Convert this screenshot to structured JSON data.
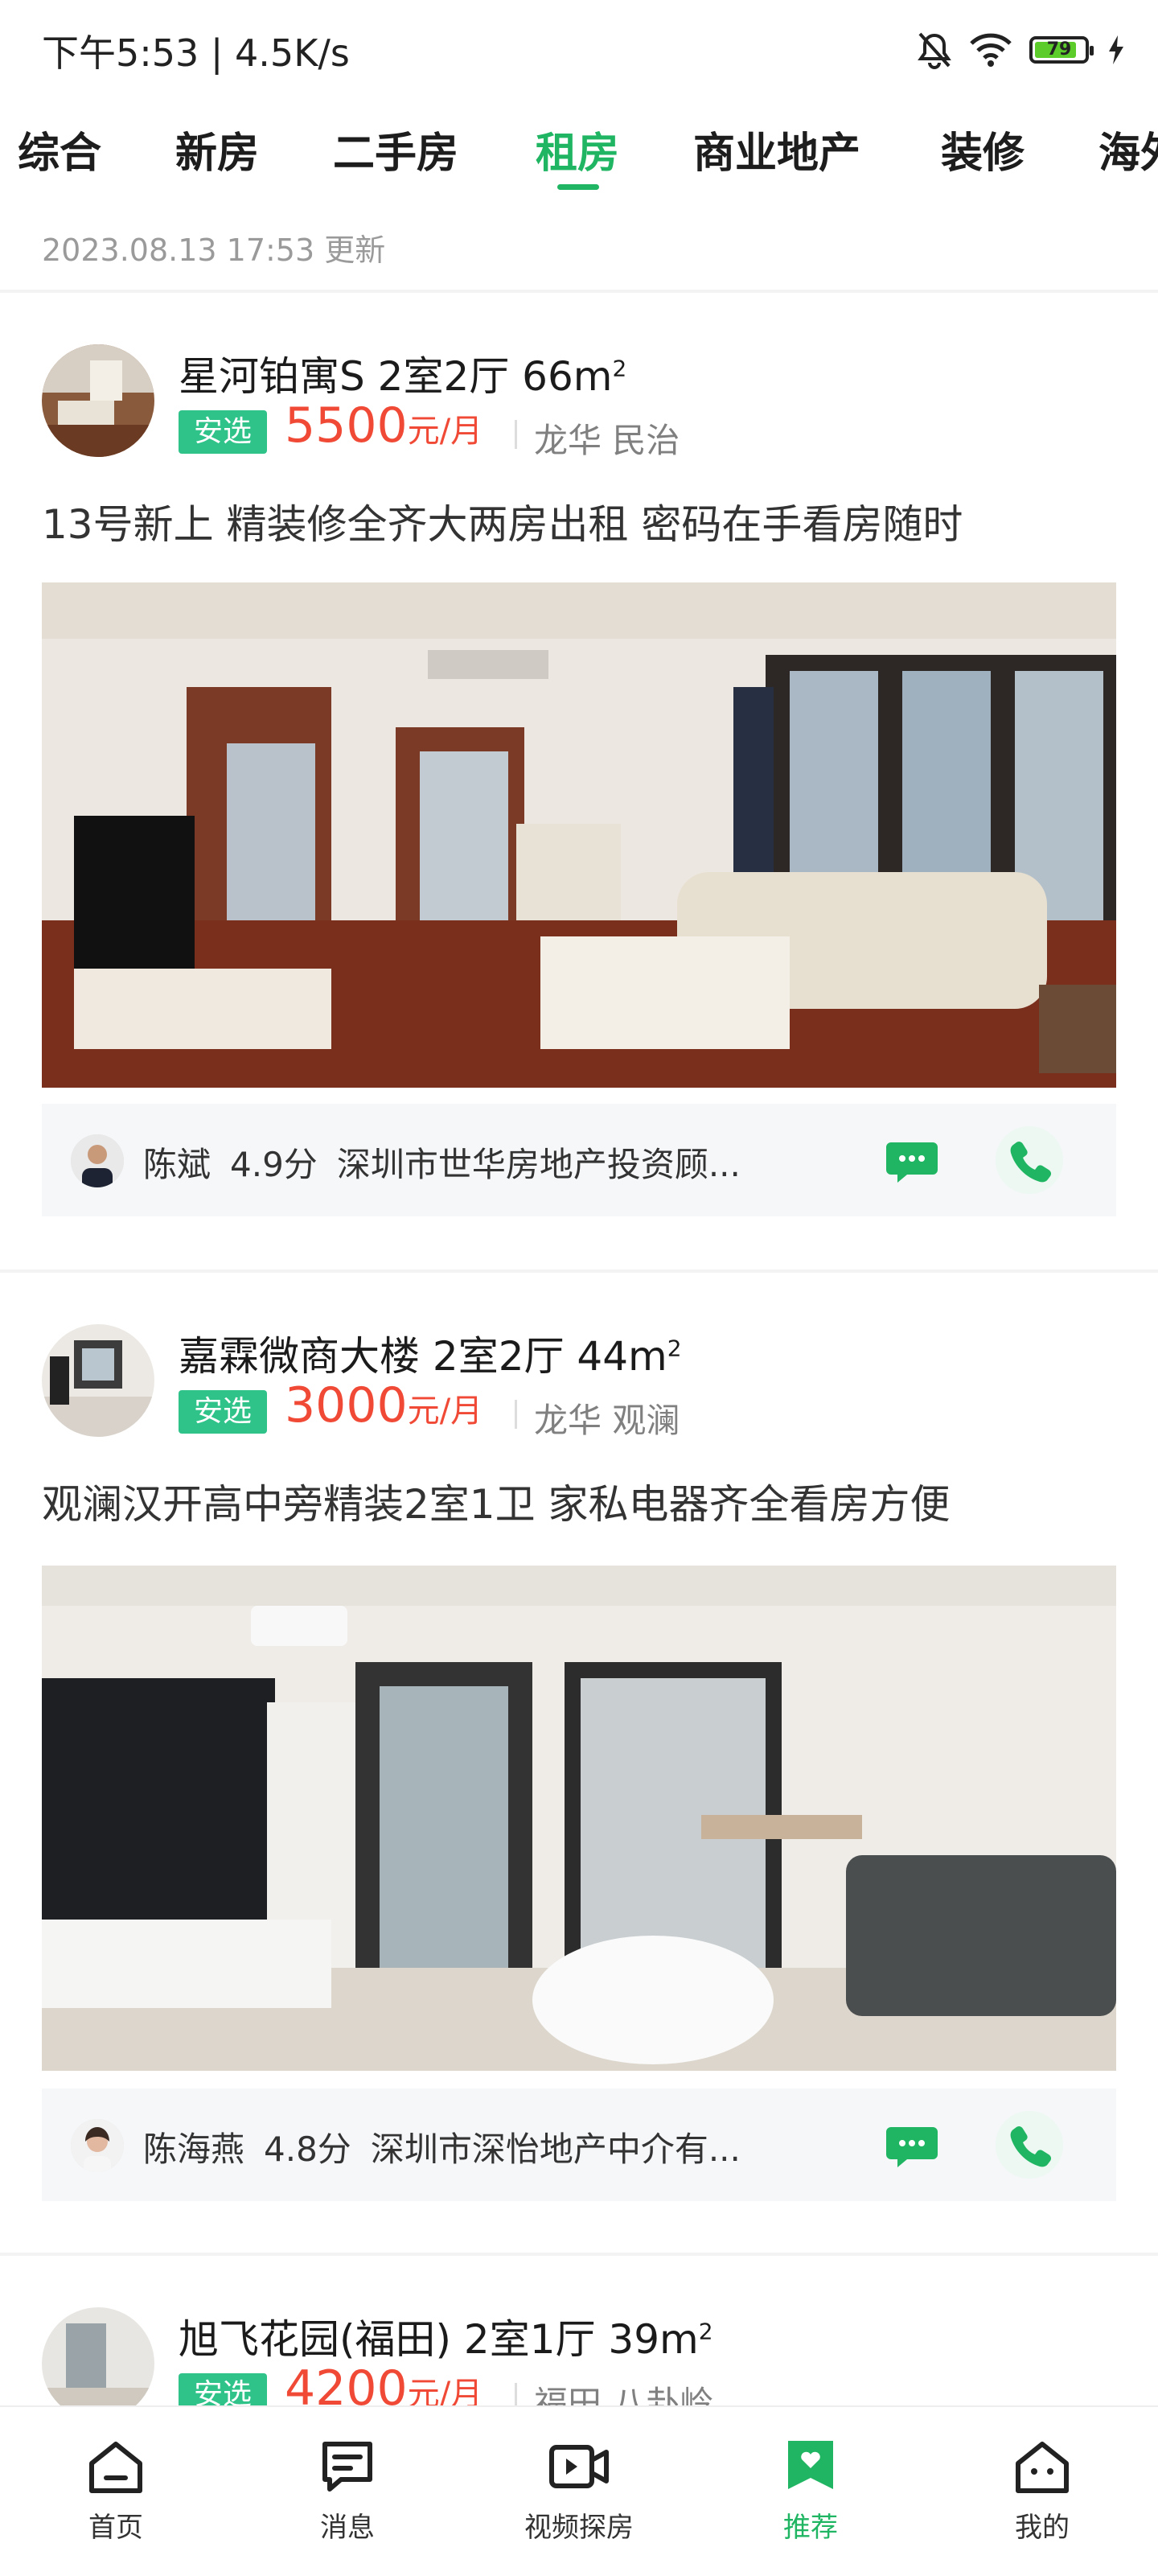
{
  "status_bar": {
    "left_text": "下午5:53 | 4.5K/s",
    "battery_level": "79",
    "icons": [
      "bell-off-icon",
      "wifi-icon",
      "battery-icon",
      "charging-icon"
    ]
  },
  "tabs": [
    {
      "label": "综合"
    },
    {
      "label": "新房"
    },
    {
      "label": "二手房"
    },
    {
      "label": "租房",
      "active": true
    },
    {
      "label": "商业地产"
    },
    {
      "label": "装修"
    },
    {
      "label": "海外"
    }
  ],
  "update_time": "2023.08.13 17:53 更新",
  "listings": [
    {
      "title": "星河铂寓S  2室2厅  66m",
      "area_sup": "2",
      "tag": "安选",
      "price": "5500",
      "price_unit": "元/月",
      "location": "龙华 民治",
      "description": "13号新上 精装修全齐大两房出租 密码在手看房随时",
      "agent": {
        "name": "陈斌",
        "score": "4.9分",
        "company": "深圳市世华房地产投资顾..."
      }
    },
    {
      "title": "嘉霖微商大楼  2室2厅  44m",
      "area_sup": "2",
      "tag": "安选",
      "price": "3000",
      "price_unit": "元/月",
      "location": "龙华 观澜",
      "description": "观澜汉开高中旁精装2室1卫 家私电器齐全看房方便",
      "agent": {
        "name": "陈海燕",
        "score": "4.8分",
        "company": "深圳市深怡地产中介有..."
      }
    },
    {
      "title": "旭飞花园(福田)  2室1厅  39m",
      "area_sup": "2",
      "tag": "安选",
      "price": "4200",
      "price_unit": "元/月",
      "location": "福田 八卦岭"
    }
  ],
  "bottom_nav": [
    {
      "label": "首页",
      "icon": "home-icon"
    },
    {
      "label": "消息",
      "icon": "message-icon"
    },
    {
      "label": "视频探房",
      "icon": "video-icon"
    },
    {
      "label": "推荐",
      "icon": "recommend-heart-icon",
      "active": true
    },
    {
      "label": "我的",
      "icon": "profile-icon"
    }
  ],
  "colors": {
    "accent": "#1fb562",
    "price": "#f04a36",
    "tag": "#2fc38a"
  }
}
